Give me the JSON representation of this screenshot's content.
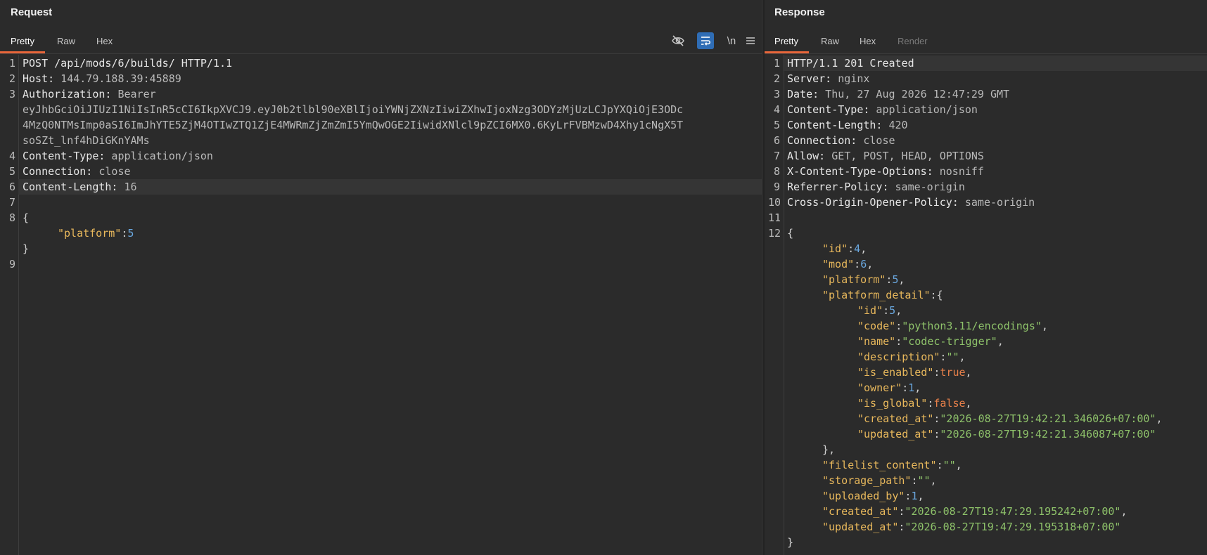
{
  "request": {
    "title": "Request",
    "tabs": [
      "Pretty",
      "Raw",
      "Hex"
    ],
    "toolbar_icons": [
      "hide-icon",
      "wrap-icon",
      "newline-icon",
      "menu-icon"
    ],
    "newline_label": "\\n",
    "line_numbers": [
      "1",
      "2",
      "3",
      "",
      "",
      "",
      "4",
      "5",
      "6",
      "7",
      "8",
      "",
      "",
      "9"
    ],
    "lines": {
      "l1": "POST /api/mods/6/builds/ HTTP/1.1",
      "host_name": "Host:",
      "host_val": " 144.79.188.39:45889",
      "auth_name": "Authorization:",
      "auth_val": " Bearer",
      "token1": "eyJhbGciOiJIUzI1NiIsInR5cCI6IkpXVCJ9.eyJ0b2tlbl90eXBlIjoiYWNjZXNzIiwiZXhwIjoxNzg3ODYzMjUzLCJpYXQiOjE3ODc",
      "token2": "4MzQ0NTMsImp0aSI6ImJhYTE5ZjM4OTIwZTQ1ZjE4MWRmZjZmZmI5YmQwOGE2IiwidXNlcl9pZCI6MX0.6KyLrFVBMzwD4Xhy1cNgX5T",
      "token3": "soSZt_lnf4hDiGKnYAMs",
      "ct_name": "Content-Type:",
      "ct_val": " application/json",
      "conn_name": "Connection:",
      "conn_val": " close",
      "cl_name": "Content-Length:",
      "cl_val": " 16",
      "brace_open": "{",
      "platform_key": "\"platform\"",
      "platform_val": "5",
      "brace_close": "}"
    }
  },
  "response": {
    "title": "Response",
    "tabs": [
      "Pretty",
      "Raw",
      "Hex",
      "Render"
    ],
    "line_numbers": [
      "1",
      "2",
      "3",
      "4",
      "5",
      "6",
      "7",
      "8",
      "9",
      "10",
      "11",
      "12"
    ],
    "status_line": "HTTP/1.1 201 Created",
    "headers": [
      {
        "name": "Server:",
        "value": " nginx"
      },
      {
        "name": "Date:",
        "value": " Thu, 27 Aug 2026 12:47:29 GMT"
      },
      {
        "name": "Content-Type:",
        "value": " application/json"
      },
      {
        "name": "Content-Length:",
        "value": " 420"
      },
      {
        "name": "Connection:",
        "value": " close"
      },
      {
        "name": "Allow:",
        "value": " GET, POST, HEAD, OPTIONS"
      },
      {
        "name": "X-Content-Type-Options:",
        "value": " nosniff"
      },
      {
        "name": "Referrer-Policy:",
        "value": " same-origin"
      },
      {
        "name": "Cross-Origin-Opener-Policy:",
        "value": " same-origin"
      }
    ],
    "body": {
      "id": "4",
      "mod": "6",
      "platform": "5",
      "pd_id": "5",
      "pd_code": "\"python3.11/encodings\"",
      "pd_name": "\"codec-trigger\"",
      "pd_description": "\"\"",
      "pd_is_enabled": "true",
      "pd_owner": "1",
      "pd_is_global": "false",
      "pd_created_at": "\"2026-08-27T19:42:21.346026+07:00\"",
      "pd_updated_at": "\"2026-08-27T19:42:21.346087+07:00\"",
      "filelist_content": "\"\"",
      "storage_path": "\"\"",
      "uploaded_by": "1",
      "created_at": "\"2026-08-27T19:47:29.195242+07:00\"",
      "updated_at": "\"2026-08-27T19:47:29.195318+07:00\""
    },
    "keys": {
      "id": "\"id\"",
      "mod": "\"mod\"",
      "platform": "\"platform\"",
      "platform_detail": "\"platform_detail\"",
      "code": "\"code\"",
      "name": "\"name\"",
      "description": "\"description\"",
      "is_enabled": "\"is_enabled\"",
      "owner": "\"owner\"",
      "is_global": "\"is_global\"",
      "created_at": "\"created_at\"",
      "updated_at": "\"updated_at\"",
      "filelist_content": "\"filelist_content\"",
      "storage_path": "\"storage_path\"",
      "uploaded_by": "\"uploaded_by\""
    }
  }
}
